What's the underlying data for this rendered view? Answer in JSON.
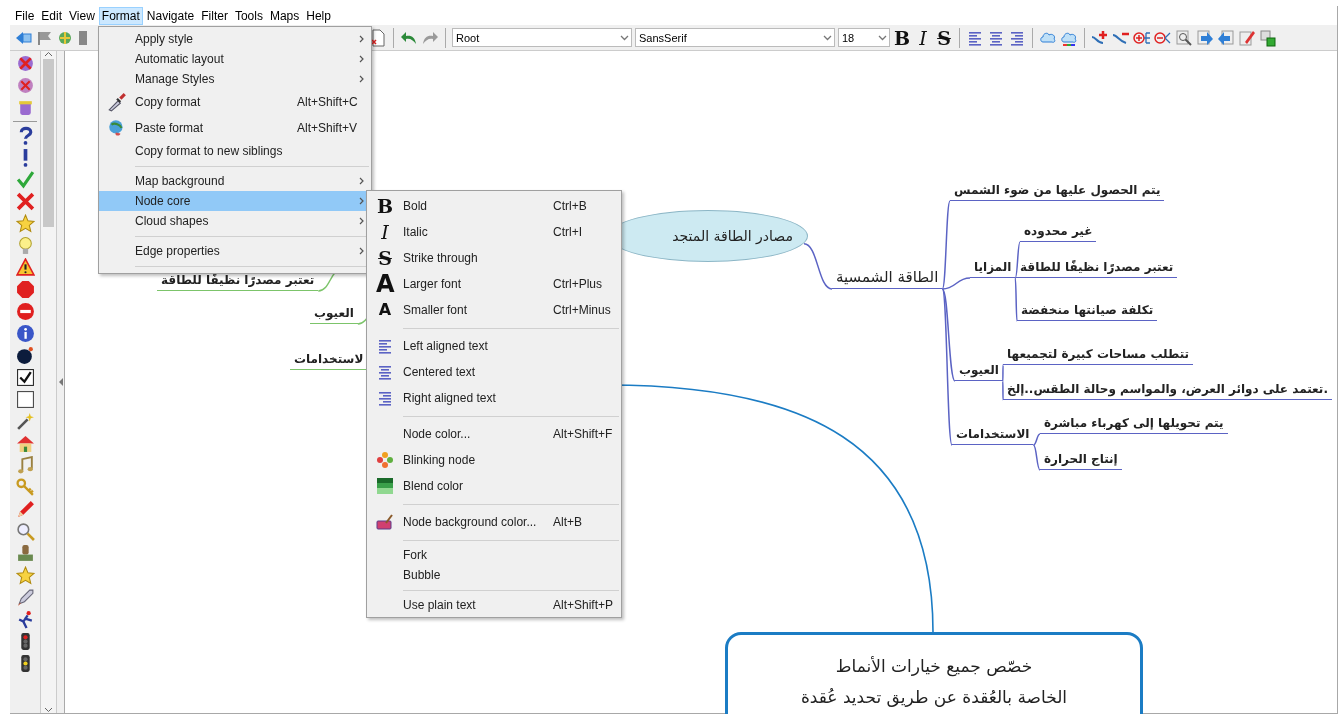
{
  "menu_bar": [
    {
      "label": "File",
      "selected": false
    },
    {
      "label": "Edit",
      "selected": false
    },
    {
      "label": "View",
      "selected": false
    },
    {
      "label": "Format",
      "selected": true
    },
    {
      "label": "Navigate",
      "selected": false
    },
    {
      "label": "Filter",
      "selected": false
    },
    {
      "label": "Tools",
      "selected": false
    },
    {
      "label": "Maps",
      "selected": false
    },
    {
      "label": "Help",
      "selected": false
    }
  ],
  "toolbar": {
    "style_select": "Root",
    "font_select": "SansSerif",
    "size_select": "18",
    "format_buttons": [
      {
        "glyph": "B",
        "kind": "bold"
      },
      {
        "glyph": "I",
        "kind": "italic"
      },
      {
        "glyph": "S",
        "kind": "strike"
      }
    ]
  },
  "format_menu": [
    {
      "kind": "item",
      "label": "Apply style",
      "submenu": true,
      "selected": false
    },
    {
      "kind": "item",
      "label": "Automatic layout",
      "submenu": true,
      "selected": false
    },
    {
      "kind": "item",
      "label": "Manage Styles",
      "submenu": true,
      "selected": false
    },
    {
      "kind": "icon",
      "label": "Copy format",
      "shortcut": "Alt+Shift+C",
      "submenu": false,
      "selected": false
    },
    {
      "kind": "icon",
      "label": "Paste format",
      "shortcut": "Alt+Shift+V",
      "submenu": false,
      "selected": false
    },
    {
      "kind": "item",
      "label": "Copy format to new siblings",
      "submenu": false,
      "selected": false
    },
    {
      "kind": "separator"
    },
    {
      "kind": "item",
      "label": "Map background",
      "submenu": true,
      "selected": false
    },
    {
      "kind": "item",
      "label": "Node core",
      "submenu": true,
      "selected": true
    },
    {
      "kind": "item",
      "label": "Cloud shapes",
      "submenu": true,
      "selected": false
    },
    {
      "kind": "separator"
    },
    {
      "kind": "item",
      "label": "Edge properties",
      "submenu": true,
      "selected": false
    },
    {
      "kind": "separator"
    }
  ],
  "node_core_menu": [
    {
      "kind": "bold",
      "glyph": "B",
      "label": "Bold",
      "shortcut": "Ctrl+B"
    },
    {
      "kind": "italic",
      "glyph": "I",
      "label": "Italic",
      "shortcut": "Ctrl+I"
    },
    {
      "kind": "strike",
      "glyph": "S",
      "label": "Strike through"
    },
    {
      "kind": "large",
      "glyph": "A",
      "label": "Larger font",
      "shortcut": "Ctrl+Plus"
    },
    {
      "kind": "small",
      "glyph": "A",
      "label": "Smaller font",
      "shortcut": "Ctrl+Minus"
    },
    {
      "kind": "separator"
    },
    {
      "kind": "icon",
      "label": "Left aligned text"
    },
    {
      "kind": "icon",
      "label": "Centered text"
    },
    {
      "kind": "icon",
      "label": "Right aligned text"
    },
    {
      "kind": "separator"
    },
    {
      "kind": "item",
      "label": "Node color...",
      "shortcut": "Alt+Shift+F"
    },
    {
      "kind": "icon",
      "label": "Blinking node"
    },
    {
      "kind": "icon",
      "label": "Blend color"
    },
    {
      "kind": "separator"
    },
    {
      "kind": "icon",
      "label": "Node background color...",
      "shortcut": "Alt+B"
    },
    {
      "kind": "separator"
    },
    {
      "kind": "short",
      "label": "Fork"
    },
    {
      "kind": "short",
      "label": "Bubble"
    },
    {
      "kind": "separator"
    },
    {
      "kind": "short",
      "label": "Use plain text",
      "shortcut": "Alt+Shift+P"
    }
  ],
  "mind_map": {
    "root": "مصادر الطاقة المتجد",
    "left": [
      {
        "label": "تعتبر مصدرًا نظيفًا للطاقة"
      },
      {
        "label": "العيوب"
      },
      {
        "label": "لاستخدامات"
      }
    ],
    "right": [
      {
        "label": "الطاقة الشمسية",
        "children": [
          {
            "label": "يتم الحصول عليها من ضوء الشمس"
          },
          {
            "label": "المزايا",
            "children": [
              {
                "label": "غير محدوده"
              },
              {
                "label": "تعتبر مصدرًا نظيفًا للطاقة"
              },
              {
                "label": "تكلفة صيانتها منخفضة"
              }
            ]
          },
          {
            "label": "العيوب",
            "children": [
              {
                "label": "تتطلب مساحات كبيرة لتجميعها"
              },
              {
                "label": "تعتمد على دوائر العرض، والمواسم وحالة الطقس..إلخ."
              }
            ]
          },
          {
            "label": "الاستخدامات",
            "children": [
              {
                "label": "يتم تحويلها إلى كهرباء مباشرة"
              },
              {
                "label": "إنتاج الحرارة"
              }
            ]
          }
        ]
      }
    ]
  },
  "callout": {
    "lines": [
      "خصّص جميع خيارات الأنماط",
      "الخاصة بالعُقدة عن طريق تحديد عُقدة"
    ]
  }
}
